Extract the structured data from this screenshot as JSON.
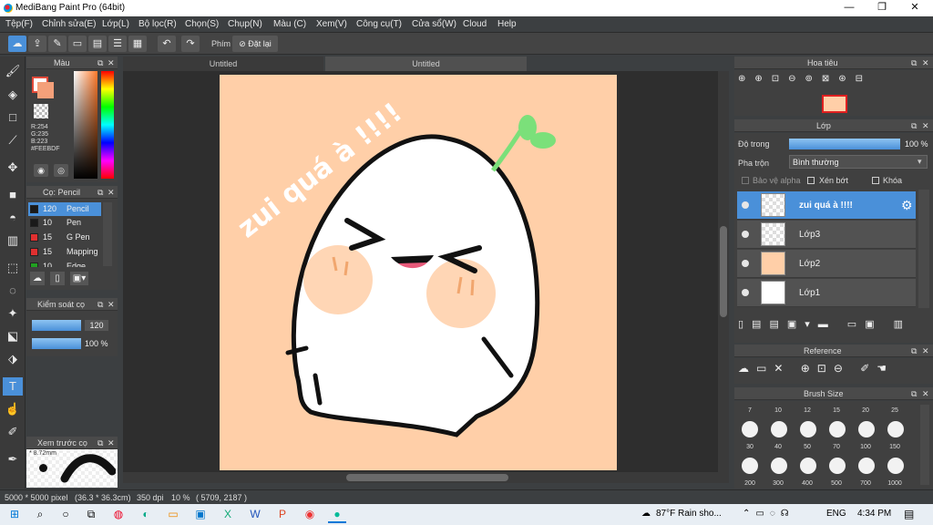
{
  "window": {
    "title": "MediBang Paint Pro (64bit)",
    "min": "—",
    "max": "❐",
    "close": "✕"
  },
  "menu": [
    "Tệp(F)",
    "Chỉnh sửa(E)",
    "Lớp(L)",
    "Bộ lọc(R)",
    "Chọn(S)",
    "Chụp(N)",
    "Màu (C)",
    "Xem(V)",
    "Công cụ(T)",
    "Cửa sổ(W)",
    "Cloud",
    "Help"
  ],
  "toolbar": {
    "shortcut_label": "Phím",
    "reset_label": "Đặt lại"
  },
  "color_panel": {
    "title": "Màu",
    "r": "R:254",
    "g": "G:235",
    "b": "B:223",
    "hex": "#FEEBDF",
    "accent": "#e34a3a"
  },
  "brush_panel": {
    "title": "Cọ: Pencil",
    "items": [
      {
        "size": "120",
        "name": "Pencil",
        "color": "#1a1a1a"
      },
      {
        "size": "10",
        "name": "Pen",
        "color": "#1a1a1a"
      },
      {
        "size": "15",
        "name": "G Pen",
        "color": "#e03030"
      },
      {
        "size": "15",
        "name": "Mapping",
        "color": "#e03030"
      },
      {
        "size": "10",
        "name": "Edge Pen",
        "color": "#20a020"
      }
    ]
  },
  "brush_control": {
    "title": "Kiểm soát cọ",
    "size": "120",
    "opacity": "100 %"
  },
  "preview": {
    "title": "Xem trước cọ",
    "size": "* 8.72mm"
  },
  "canvas_tabs": [
    "Untitled",
    "Untitled"
  ],
  "artwork": {
    "text": "zui quá à !!!!",
    "bg": "#ffcfa8"
  },
  "status": {
    "dims": "5000 * 5000 pixel",
    "mm": "(36.3 * 36.3cm)",
    "dpi": "350 dpi",
    "zoom": "10 %",
    "coords": "( 5709, 2187 )"
  },
  "navigator": {
    "title": "Hoa tiêu"
  },
  "layer_panel": {
    "title": "Lớp",
    "opacity_label": "Độ trong",
    "opacity_value": "100 %",
    "blend_label": "Pha trộn",
    "blend_value": "Bình thường",
    "protect_alpha": "Bảo vệ alpha",
    "clipping": "Xén bớt",
    "lock": "Khóa",
    "layers": [
      {
        "name": "zui quá à !!!!",
        "selected": true
      },
      {
        "name": "Lớp3"
      },
      {
        "name": "Lớp2"
      },
      {
        "name": "Lớp1"
      }
    ]
  },
  "reference": {
    "title": "Reference"
  },
  "brush_size": {
    "title": "Brush Size",
    "row1": [
      "7",
      "10",
      "12",
      "15",
      "20",
      "25"
    ],
    "row2": [
      "30",
      "40",
      "50",
      "70",
      "100",
      "150"
    ],
    "row3": [
      "200",
      "300",
      "400",
      "500",
      "700",
      "1000"
    ]
  },
  "taskbar": {
    "weather": "87°F  Rain sho...",
    "lang": "ENG",
    "time": "4:34 PM"
  }
}
